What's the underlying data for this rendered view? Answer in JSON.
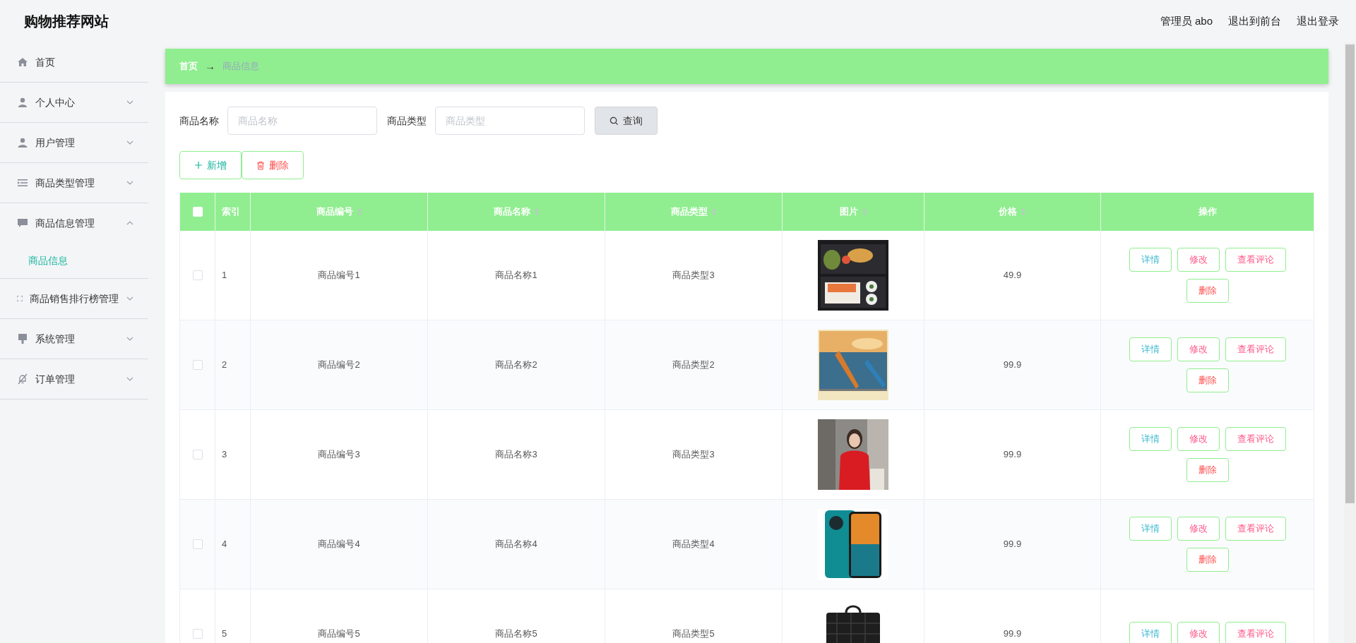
{
  "header": {
    "title": "购物推荐网站",
    "links": [
      "管理员 abo",
      "退出到前台",
      "退出登录"
    ]
  },
  "sidebar": {
    "items": [
      {
        "kind": "link",
        "label": "首页"
      },
      {
        "kind": "submenu",
        "label": "个人中心",
        "expanded": false
      },
      {
        "kind": "submenu",
        "label": "用户管理",
        "expanded": false
      },
      {
        "kind": "submenu",
        "label": "商品类型管理",
        "expanded": false
      },
      {
        "kind": "submenu",
        "label": "商品信息管理",
        "expanded": true,
        "children": [
          {
            "label": "商品信息",
            "selected": true
          }
        ]
      },
      {
        "kind": "submenu",
        "label": "商品销售排行榜管理",
        "expanded": false
      },
      {
        "kind": "submenu",
        "label": "系统管理",
        "expanded": false
      },
      {
        "kind": "submenu",
        "label": "订单管理",
        "expanded": false
      }
    ]
  },
  "breadcrumb": {
    "home": "首页",
    "separator": "→",
    "current": "商品信息"
  },
  "search": {
    "fields": [
      {
        "label": "商品名称",
        "placeholder": "商品名称"
      },
      {
        "label": "商品类型",
        "placeholder": "商品类型"
      }
    ],
    "button": "查询"
  },
  "toolbar": [
    {
      "kind": "add",
      "label": "新增"
    },
    {
      "kind": "delete",
      "label": "删除"
    }
  ],
  "table": {
    "select_all": {
      "checked": false
    },
    "columns": [
      {
        "label": "索引",
        "sortable": false
      },
      {
        "label": "商品编号",
        "sortable": true
      },
      {
        "label": "商品名称",
        "sortable": true
      },
      {
        "label": "商品类型",
        "sortable": true
      },
      {
        "label": "图片",
        "sortable": true
      },
      {
        "label": "价格",
        "sortable": true
      },
      {
        "label": "操作",
        "sortable": false
      }
    ],
    "rows": [
      {
        "checked": false,
        "index": "1",
        "code": "商品编号1",
        "name": "商品名称1",
        "type": "商品类型3",
        "image": {
          "kind": "picture"
        },
        "price": "49.9",
        "actions": [
          {
            "kind": "detail",
            "label": "详情"
          },
          {
            "kind": "edit",
            "label": "修改"
          },
          {
            "kind": "comments",
            "label": "查看评论"
          },
          {
            "kind": "delete",
            "label": "删除"
          }
        ]
      },
      {
        "checked": false,
        "index": "2",
        "code": "商品编号2",
        "name": "商品名称2",
        "type": "商品类型2",
        "image": {
          "kind": "picture"
        },
        "price": "99.9",
        "actions": [
          {
            "kind": "detail",
            "label": "详情"
          },
          {
            "kind": "edit",
            "label": "修改"
          },
          {
            "kind": "comments",
            "label": "查看评论"
          },
          {
            "kind": "delete",
            "label": "删除"
          }
        ]
      },
      {
        "checked": false,
        "index": "3",
        "code": "商品编号3",
        "name": "商品名称3",
        "type": "商品类型3",
        "image": {
          "kind": "picture"
        },
        "price": "99.9",
        "actions": [
          {
            "kind": "detail",
            "label": "详情"
          },
          {
            "kind": "edit",
            "label": "修改"
          },
          {
            "kind": "comments",
            "label": "查看评论"
          },
          {
            "kind": "delete",
            "label": "删除"
          }
        ]
      },
      {
        "checked": false,
        "index": "4",
        "code": "商品编号4",
        "name": "商品名称4",
        "type": "商品类型4",
        "image": {
          "kind": "picture"
        },
        "price": "99.9",
        "actions": [
          {
            "kind": "detail",
            "label": "详情"
          },
          {
            "kind": "edit",
            "label": "修改"
          },
          {
            "kind": "comments",
            "label": "查看评论"
          },
          {
            "kind": "delete",
            "label": "删除"
          }
        ]
      },
      {
        "checked": false,
        "index": "5",
        "code": "商品编号5",
        "name": "商品名称5",
        "type": "商品类型5",
        "image": {
          "kind": "picture"
        },
        "price": "99.9",
        "actions": [
          {
            "kind": "detail",
            "label": "详情"
          },
          {
            "kind": "edit",
            "label": "修改"
          },
          {
            "kind": "comments",
            "label": "查看评论"
          }
        ]
      }
    ]
  }
}
